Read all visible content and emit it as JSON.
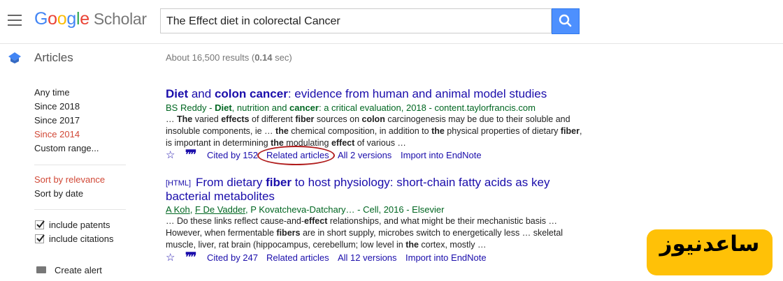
{
  "header": {
    "logo_google": [
      "G",
      "o",
      "o",
      "g",
      "l",
      "e"
    ],
    "logo_scholar": "Scholar",
    "search_value": "The Effect diet in colorectal Cancer"
  },
  "section_label": "Articles",
  "results_summary": {
    "prefix": "About 16,500 results (",
    "time": "0.14",
    "suffix": " sec)"
  },
  "sidebar": {
    "time_filters": [
      "Any time",
      "Since 2018",
      "Since 2017",
      "Since 2014",
      "Custom range..."
    ],
    "time_selected": "Since 2014",
    "sort_options": [
      "Sort by relevance",
      "Sort by date"
    ],
    "sort_selected": "Sort by relevance",
    "checkboxes": [
      {
        "label": "include patents",
        "checked": true
      },
      {
        "label": "include citations",
        "checked": true
      }
    ],
    "create_alert": "Create alert"
  },
  "results": [
    {
      "tag": "",
      "title_parts": [
        [
          "Diet",
          true
        ],
        [
          " and ",
          false
        ],
        [
          "colon cancer",
          true
        ],
        [
          ": evidence from human and animal model studies",
          false
        ]
      ],
      "meta_parts": [
        [
          "BS Reddy - ",
          false
        ],
        [
          "Diet",
          true
        ],
        [
          ", nutrition and ",
          false
        ],
        [
          "cancer",
          true
        ],
        [
          ": a critical evaluation, 2018 - content.taylorfrancis.com",
          false
        ]
      ],
      "snippet": "… <b>The</b> varied <b>effects</b> of different <b>fiber</b> sources on <b>colon</b> carcinogenesis may be due to their soluble and insoluble components, ie … <b>the</b> chemical composition, in addition to <b>the</b> physical properties of dietary <b>fiber</b>, is important in determining <b>the</b> modulating <b>effect</b> of various …",
      "cited_by": "Cited by 152",
      "related": "Related articles",
      "versions": "All 2 versions",
      "endnote": "Import into EndNote"
    },
    {
      "tag": "[HTML]",
      "title_parts": [
        [
          "From dietary ",
          false
        ],
        [
          "fiber",
          true
        ],
        [
          " to host physiology: short-chain fatty acids as key bacterial metabolites",
          false
        ]
      ],
      "meta_parts": [
        [
          "A Koh",
          false,
          true
        ],
        [
          ", ",
          false
        ],
        [
          "F De Vadder",
          false,
          true
        ],
        [
          ", P Kovatcheva-Datchary… - Cell, 2016 - Elsevier",
          false
        ]
      ],
      "snippet": "… Do these links reflect cause-and-<b>effect</b> relationships, and what might be their mechanistic basis … However, when fermentable <b>fibers</b> are in short supply, microbes switch to energetically less … skeletal muscle, liver, rat brain (hippocampus, cerebellum; low level in <b>the</b> cortex, mostly …",
      "cited_by": "Cited by 247",
      "related": "Related articles",
      "versions": "All 12 versions",
      "endnote": "Import into EndNote"
    }
  ],
  "watermark": "ساعدنیوز",
  "colors": {
    "link": "#1a0dab",
    "green": "#006621",
    "selected": "#d14836",
    "search_button": "#4d90fe",
    "watermark_bg": "#ffc107",
    "annotation": "#b01c1c"
  }
}
